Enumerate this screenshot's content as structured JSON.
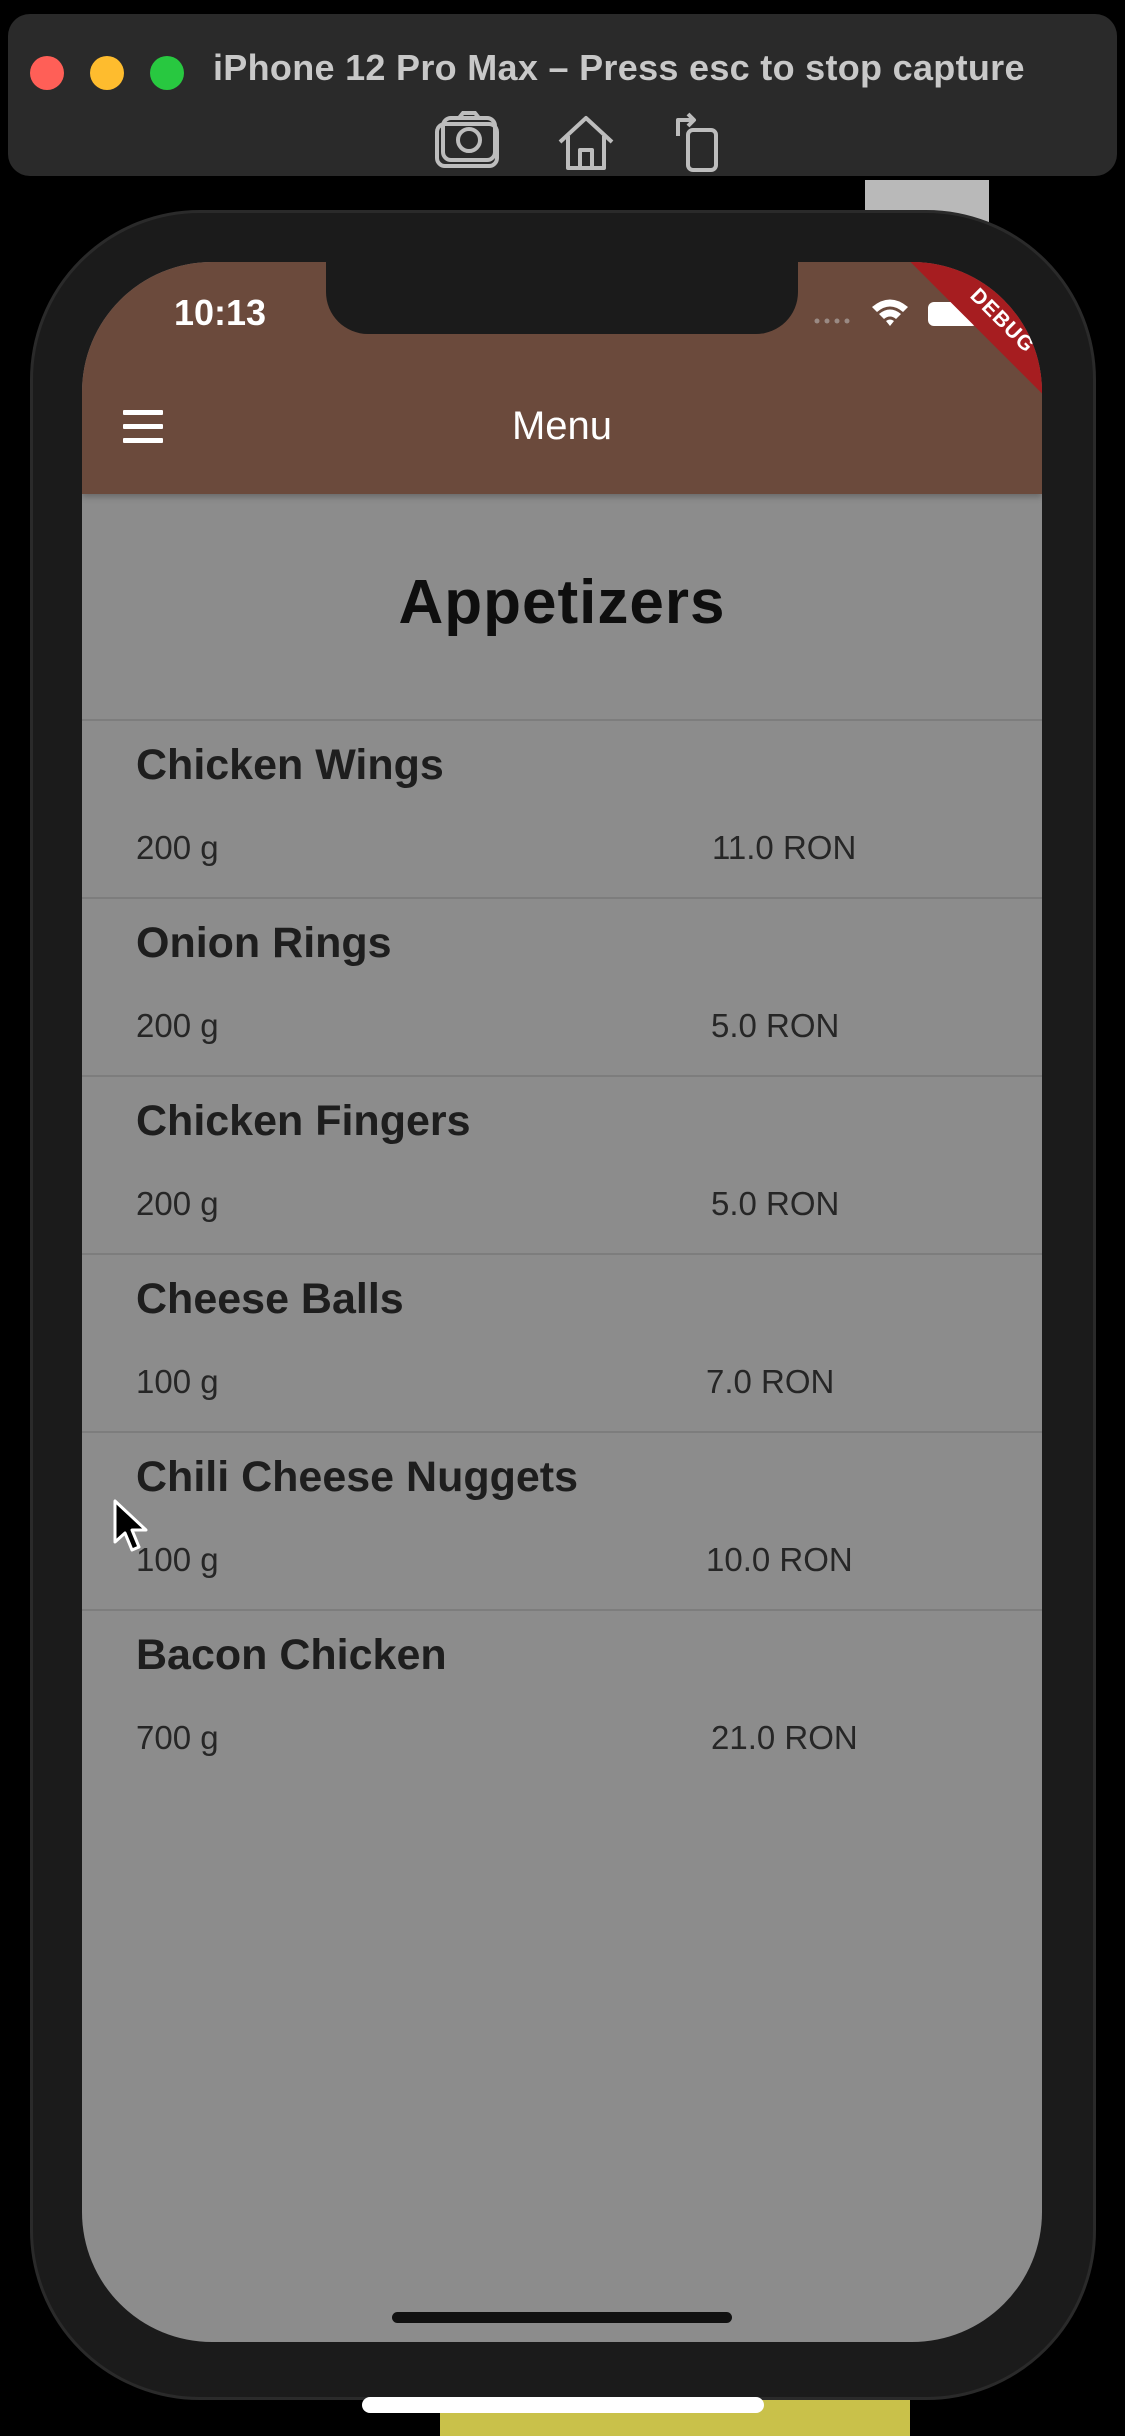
{
  "capture_window": {
    "title": "iPhone 12 Pro Max – Press esc to stop capture",
    "icons": [
      "screenshot-icon",
      "home-icon",
      "rotate-icon"
    ]
  },
  "status_bar": {
    "time": "10:13",
    "debug_label": "DEBUG"
  },
  "appbar": {
    "title": "Menu",
    "menu_icon": "hamburger-menu-icon",
    "color": "#6b4a3c"
  },
  "section": {
    "title": "Appetizers"
  },
  "items": [
    {
      "name": "Chicken Wings",
      "weight": "200 g",
      "price": "11.0 RON"
    },
    {
      "name": "Onion Rings",
      "weight": "200 g",
      "price": "5.0 RON"
    },
    {
      "name": "Chicken Fingers",
      "weight": "200 g",
      "price": "5.0 RON"
    },
    {
      "name": "Cheese Balls",
      "weight": "100 g",
      "price": "7.0 RON"
    },
    {
      "name": "Chili Cheese Nuggets",
      "weight": "100 g",
      "price": "10.0 RON"
    },
    {
      "name": "Bacon Chicken",
      "weight": "700 g",
      "price": "21.0 RON"
    }
  ],
  "colors": {
    "scrim_background": "#8c8c8c",
    "debug_banner": "#a61d20"
  }
}
